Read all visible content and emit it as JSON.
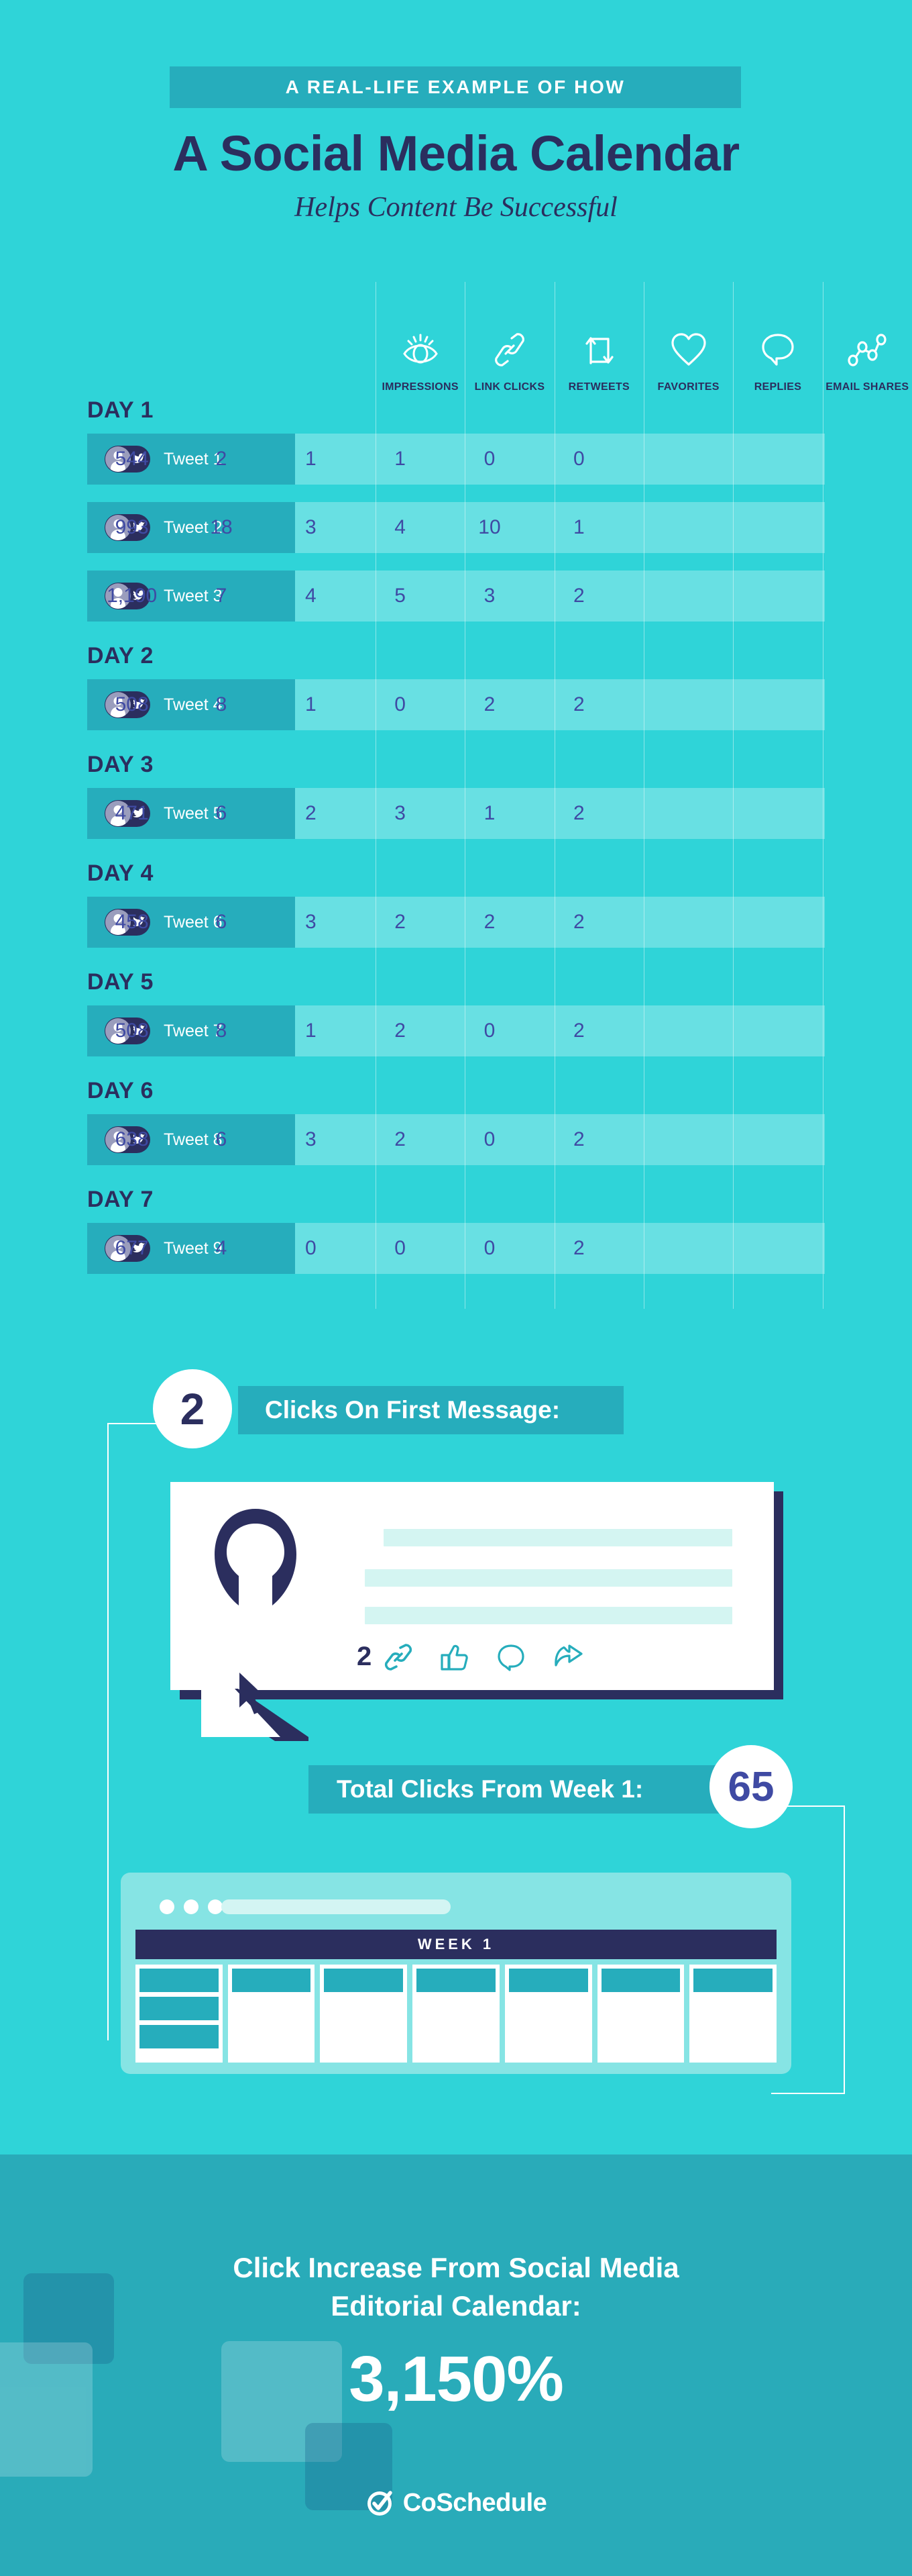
{
  "header": {
    "ribbon": "A REAL-LIFE EXAMPLE OF HOW",
    "title": "A Social Media Calendar",
    "subtitle": "Helps Content Be Successful"
  },
  "colors": {
    "bg_top": "#2fd4d8",
    "bg_footer": "#29abb9",
    "accent_bar": "#26adbc",
    "navy": "#2b2e5e",
    "value_text": "#3f4aa3"
  },
  "table": {
    "columns": [
      {
        "label": "IMPRESSIONS",
        "icon": "eye-icon"
      },
      {
        "label": "LINK CLICKS",
        "icon": "link-icon"
      },
      {
        "label": "RETWEETS",
        "icon": "retweet-icon"
      },
      {
        "label": "FAVORITES",
        "icon": "heart-icon"
      },
      {
        "label": "REPLIES",
        "icon": "speech-bubble-icon"
      },
      {
        "label": "EMAIL SHARES",
        "icon": "network-share-icon"
      }
    ],
    "groups": [
      {
        "day": "DAY 1",
        "rows": [
          {
            "name": "Tweet 1",
            "values": [
              "544",
              "2",
              "1",
              "1",
              "0",
              "0"
            ]
          },
          {
            "name": "Tweet 2",
            "values": [
              "993",
              "18",
              "3",
              "4",
              "10",
              "1"
            ]
          },
          {
            "name": "Tweet 3",
            "values": [
              "1,190",
              "7",
              "4",
              "5",
              "3",
              "2"
            ]
          }
        ]
      },
      {
        "day": "DAY 2",
        "rows": [
          {
            "name": "Tweet 4",
            "values": [
              "508",
              "8",
              "1",
              "0",
              "2",
              "2"
            ]
          }
        ]
      },
      {
        "day": "DAY 3",
        "rows": [
          {
            "name": "Tweet 5",
            "values": [
              "471",
              "6",
              "2",
              "3",
              "1",
              "2"
            ]
          }
        ]
      },
      {
        "day": "DAY 4",
        "rows": [
          {
            "name": "Tweet 6",
            "values": [
              "458",
              "6",
              "3",
              "2",
              "2",
              "2"
            ]
          }
        ]
      },
      {
        "day": "DAY 5",
        "rows": [
          {
            "name": "Tweet 7",
            "values": [
              "508",
              "8",
              "1",
              "2",
              "0",
              "2"
            ]
          }
        ]
      },
      {
        "day": "DAY 6",
        "rows": [
          {
            "name": "Tweet 8",
            "values": [
              "638",
              "6",
              "3",
              "2",
              "0",
              "2"
            ]
          }
        ]
      },
      {
        "day": "DAY 7",
        "rows": [
          {
            "name": "Tweet 9",
            "values": [
              "677",
              "4",
              "0",
              "0",
              "0",
              "2"
            ]
          }
        ]
      }
    ]
  },
  "chart_data": {
    "type": "table",
    "title": "A Social Media Calendar Helps Content Be Successful",
    "columns": [
      "Tweet",
      "Impressions",
      "Link Clicks",
      "Retweets",
      "Favorites",
      "Replies",
      "Email Shares"
    ],
    "rows": [
      {
        "day": "DAY 1",
        "tweet": "Tweet 1",
        "impressions": 544,
        "link_clicks": 2,
        "retweets": 1,
        "favorites": 1,
        "replies": 0,
        "email_shares": 0
      },
      {
        "day": "DAY 1",
        "tweet": "Tweet 2",
        "impressions": 993,
        "link_clicks": 18,
        "retweets": 3,
        "favorites": 4,
        "replies": 10,
        "email_shares": 1
      },
      {
        "day": "DAY 1",
        "tweet": "Tweet 3",
        "impressions": 1190,
        "link_clicks": 7,
        "retweets": 4,
        "favorites": 5,
        "replies": 3,
        "email_shares": 2
      },
      {
        "day": "DAY 2",
        "tweet": "Tweet 4",
        "impressions": 508,
        "link_clicks": 8,
        "retweets": 1,
        "favorites": 0,
        "replies": 2,
        "email_shares": 2
      },
      {
        "day": "DAY 3",
        "tweet": "Tweet 5",
        "impressions": 471,
        "link_clicks": 6,
        "retweets": 2,
        "favorites": 3,
        "replies": 1,
        "email_shares": 2
      },
      {
        "day": "DAY 4",
        "tweet": "Tweet 6",
        "impressions": 458,
        "link_clicks": 6,
        "retweets": 3,
        "favorites": 2,
        "replies": 2,
        "email_shares": 2
      },
      {
        "day": "DAY 5",
        "tweet": "Tweet 7",
        "impressions": 508,
        "link_clicks": 8,
        "retweets": 1,
        "favorites": 2,
        "replies": 0,
        "email_shares": 2
      },
      {
        "day": "DAY 6",
        "tweet": "Tweet 8",
        "impressions": 638,
        "link_clicks": 6,
        "retweets": 3,
        "favorites": 2,
        "replies": 0,
        "email_shares": 2
      },
      {
        "day": "DAY 7",
        "tweet": "Tweet 9",
        "impressions": 677,
        "link_clicks": 4,
        "retweets": 0,
        "favorites": 0,
        "replies": 0,
        "email_shares": 2
      }
    ],
    "callouts": {
      "clicks_on_first_message": 2,
      "total_clicks_week_1": 65,
      "click_increase_percent": "3,150%"
    }
  },
  "callout_first": {
    "badge": "2",
    "label": "Clicks On First Message:"
  },
  "tweet_card": {
    "click_count": "2",
    "actions": [
      "link-icon",
      "thumbs-up-icon",
      "comment-icon",
      "share-icon"
    ]
  },
  "callout_total": {
    "label": "Total Clicks From Week 1:",
    "badge": "65"
  },
  "browser": {
    "week_title": "WEEK 1",
    "columns": 7
  },
  "footer": {
    "line1": "Click Increase From Social Media",
    "line2": "Editorial Calendar:",
    "percent": "3,150%",
    "brand": "CoSchedule"
  }
}
